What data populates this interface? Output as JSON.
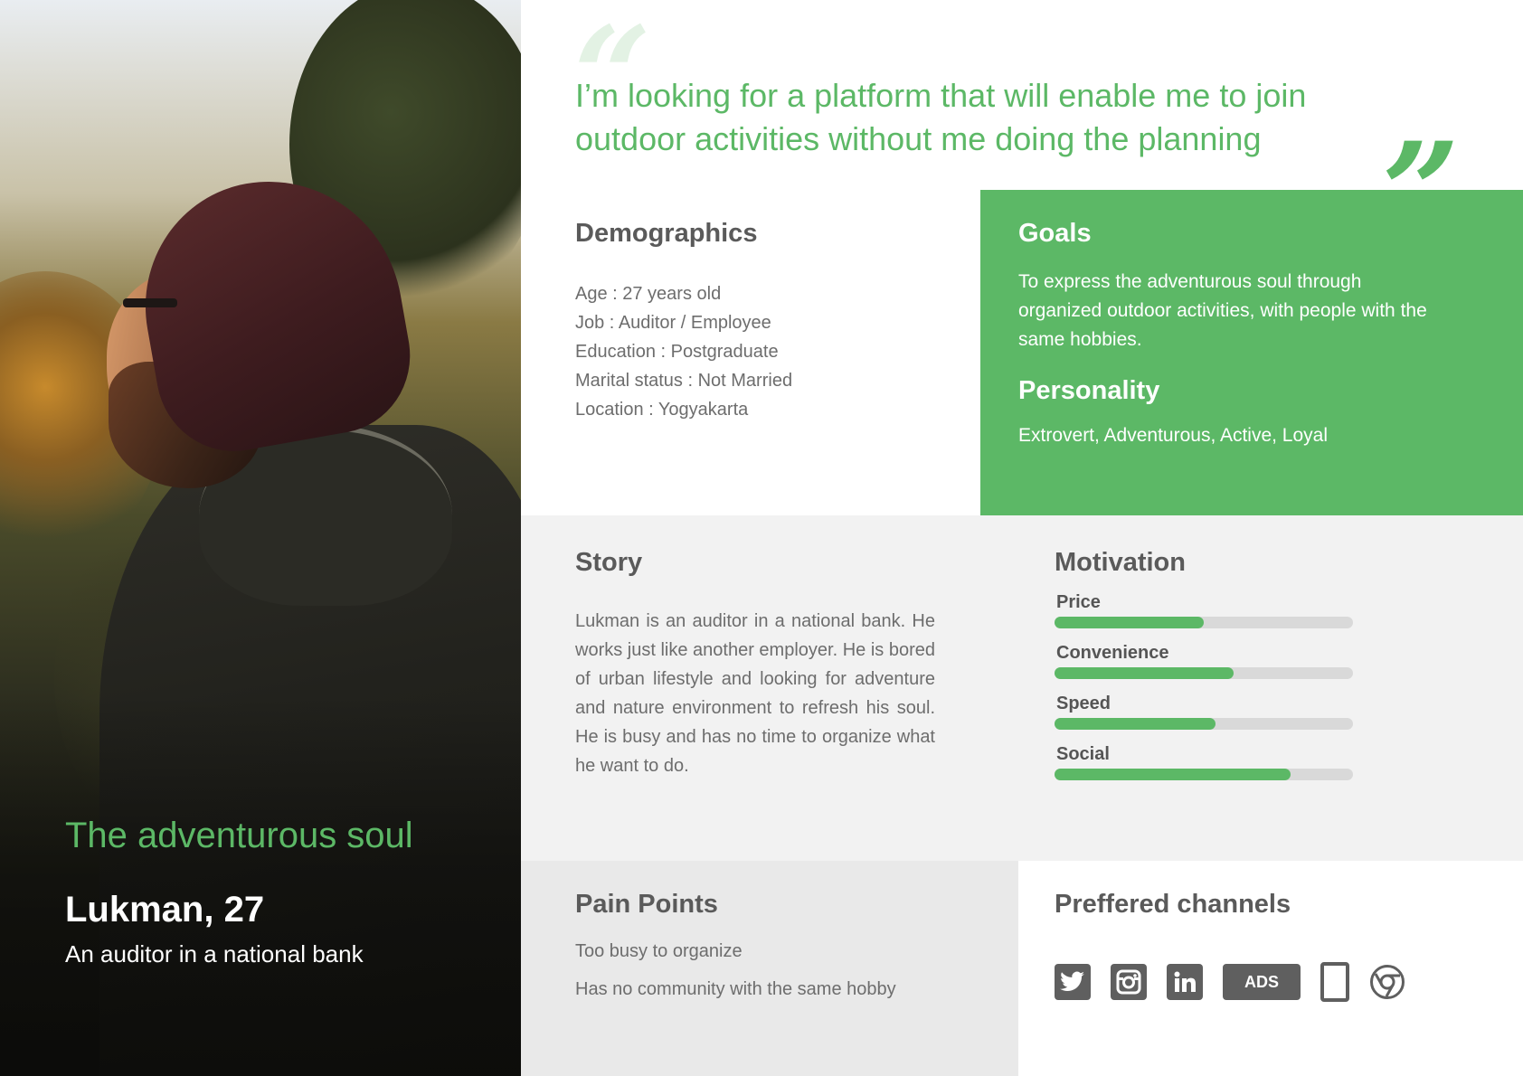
{
  "persona": {
    "tagline": "The adventurous soul",
    "name": "Lukman, 27",
    "role": "An auditor in a national bank"
  },
  "quote": {
    "open_mark": "“",
    "text": "I’m looking for a platform that will enable me to join outdoor activities without me doing the planning",
    "close_mark": "”"
  },
  "demographics": {
    "title": "Demographics",
    "items": [
      "Age : 27 years old",
      "Job : Auditor / Employee",
      "Education : Postgraduate",
      "Marital status : Not Married",
      "Location : Yogyakarta"
    ]
  },
  "goals": {
    "title": "Goals",
    "text": "To express the adventurous soul through organized outdoor activities, with people with the same hobbies."
  },
  "personality": {
    "title": "Personality",
    "text": "Extrovert, Adventurous, Active, Loyal"
  },
  "story": {
    "title": "Story",
    "text": "Lukman is an auditor in a national bank. He works just like another employer. He is bored of urban lifestyle and looking for adventure and nature environment to refresh his soul. He is busy and has no time to organize what he want to do."
  },
  "motivation": {
    "title": "Motivation",
    "items": [
      {
        "label": "Price",
        "level": 0.5
      },
      {
        "label": "Convenience",
        "level": 0.6
      },
      {
        "label": "Speed",
        "level": 0.54
      },
      {
        "label": "Social",
        "level": 0.79
      }
    ]
  },
  "pain_points": {
    "title": "Pain Points",
    "items": [
      "Too busy to organize",
      "Has no community with the same hobby"
    ]
  },
  "channels": {
    "title": "Preffered channels",
    "items": [
      {
        "icon": "twitter-icon"
      },
      {
        "icon": "instagram-icon"
      },
      {
        "icon": "linkedin-icon"
      },
      {
        "icon": "ads-badge",
        "label": "ADS"
      },
      {
        "icon": "mobile-phone-icon"
      },
      {
        "icon": "chrome-browser-icon"
      }
    ]
  },
  "colors": {
    "accent": "#5cb866",
    "text": "#555555",
    "panel_gray": "#f2f2f2",
    "panel_gray_dark": "#e9e9e9",
    "icon_gray": "#5f5f5f"
  }
}
